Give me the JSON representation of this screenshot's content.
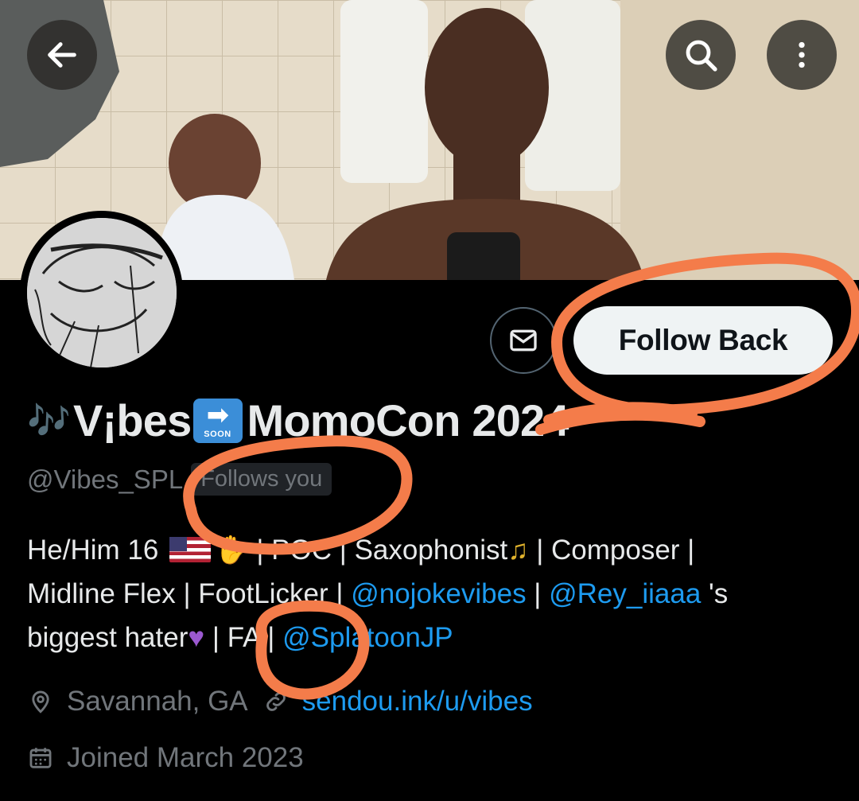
{
  "header": {
    "back_icon": "arrow-left-icon",
    "search_icon": "search-icon",
    "more_icon": "more-vertical-icon"
  },
  "profile": {
    "display_name_prefix": "🎶",
    "display_name_main": "V¡bes",
    "soon_emoji_text": "SOON",
    "display_name_event": "MomoCon 2024",
    "handle": "@Vibes_SPL",
    "follows_you": "Follows you"
  },
  "actions": {
    "message_icon": "mail-icon",
    "follow_back_label": "Follow Back"
  },
  "bio": {
    "line1_a": "He/Him 16 ",
    "line1_b": " | POC | Saxophonist",
    "line1_c": " | Composer |",
    "line2_a": "Midline Flex | FootLicker | ",
    "mention1": "@nojokevibes",
    "line2_b": " | ",
    "mention2": "@Rey_iiaaa",
    "line2_c": " 's",
    "line3_a": "biggest hater",
    "line3_b": " | FA | ",
    "mention3": "@SplatoonJP"
  },
  "meta": {
    "location": "Savannah, GA",
    "website": "sendou.ink/u/vibes",
    "joined": "Joined March 2023"
  },
  "colors": {
    "background": "#000000",
    "accent_link": "#1d9bf0",
    "muted_text": "#71767b",
    "annotation_orange": "#f47c4a"
  }
}
